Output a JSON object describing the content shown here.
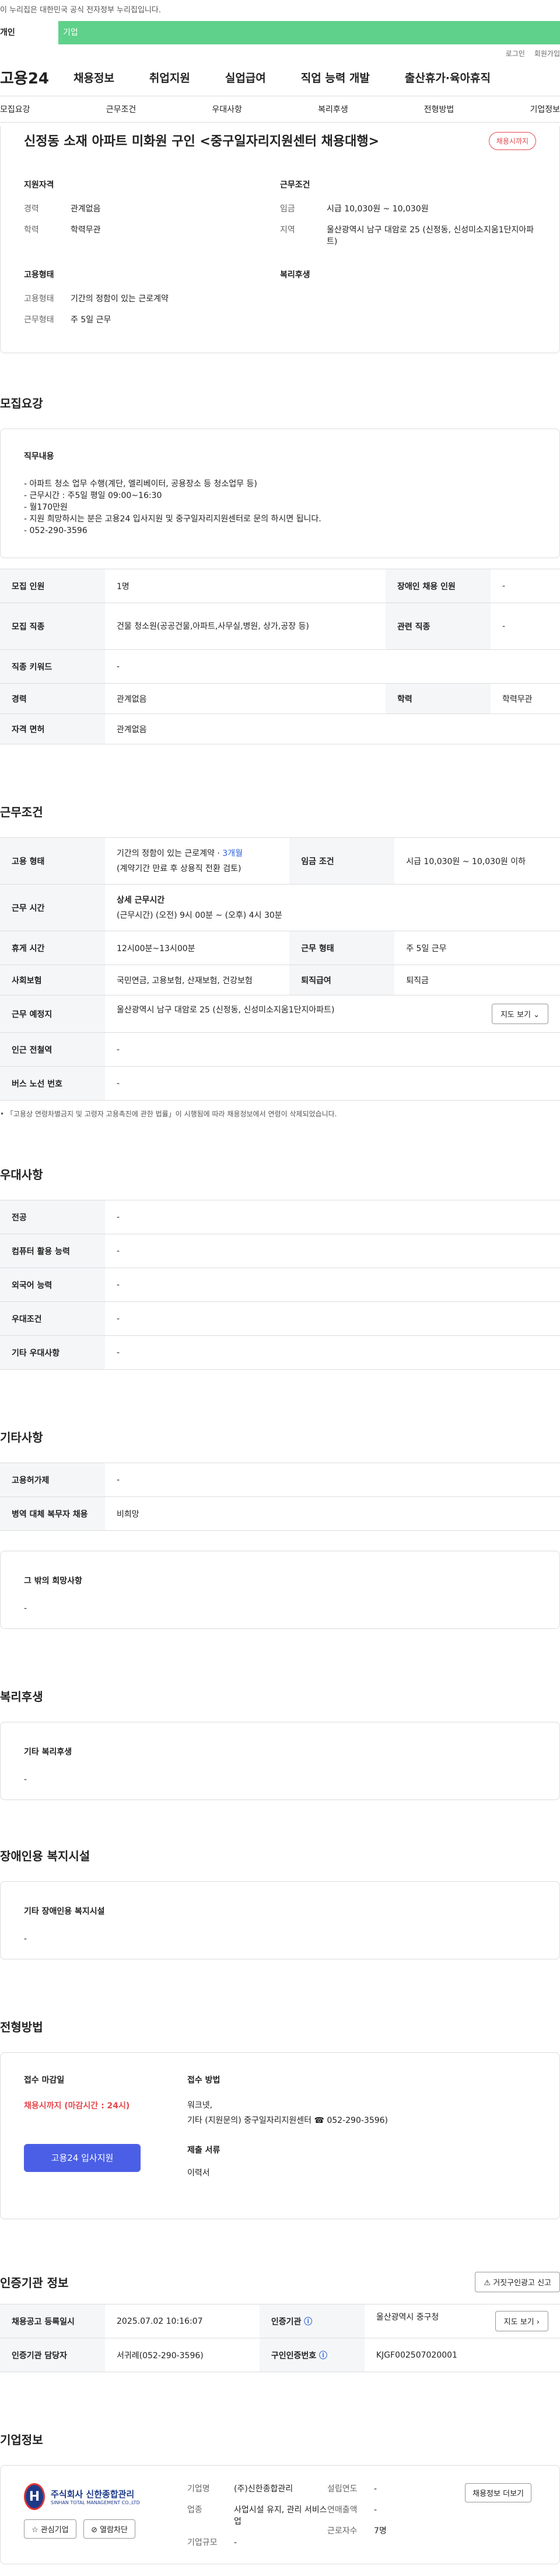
{
  "gov_banner": "이 누리집은 대한민국 공식 전자정부 누리집입니다.",
  "tabs": [
    "개인",
    "기업"
  ],
  "top_links": [
    "로그인",
    "회원가입"
  ],
  "gnb": {
    "logo": "고용24",
    "items": [
      "채용정보",
      "취업지원",
      "실업급여",
      "직업 능력 개발",
      "출산휴가·육아휴직"
    ]
  },
  "subnav": [
    "모집요강",
    "근무조건",
    "우대사항",
    "복리후생",
    "전형방법",
    "기업정보"
  ],
  "job": {
    "title": "신정동 소재 아파트 미화원 구인 <중구일자리지원센터 채용대행>",
    "badge": "채용시까지",
    "qual_title": "지원자격",
    "qual": [
      [
        "경력",
        "관계없음"
      ],
      [
        "학력",
        "학력무관"
      ]
    ],
    "cond_title": "근무조건",
    "cond": [
      [
        "임금",
        "시급 10,030원 ~ 10,030원"
      ],
      [
        "지역",
        "울산광역시 남구 대암로 25 (신정동, 신성미소지움1단지아파트)"
      ]
    ],
    "emp_title": "고용형태",
    "emp": [
      [
        "고용형태",
        "기간의 정함이 있는 근로계약"
      ],
      [
        "근무형태",
        "주 5일 근무"
      ]
    ],
    "benefit_title": "복리후생"
  },
  "recruit": {
    "title": "모집요강",
    "duty_title": "직무내용",
    "duty_lines": [
      "- 아파트 청소 업무 수행(계단, 엘리베이터, 공용장소 등 청소업무 등)",
      "- 근무시간 : 주5일 평일 09:00~16:30",
      "- 월170만원",
      "- 지원 희망하시는 분은 고용24 입사지원 및 중구일자리지원센터로 문의 하시면 됩니다.",
      "- 052-290-3596"
    ],
    "rows": [
      [
        "모집 인원",
        "1명",
        "장애인 채용 인원",
        "-"
      ],
      [
        "모집 직종",
        "건물 청소원(공공건물,아파트,사무실,병원, 상가,공장 등)",
        "관련 직종",
        "-"
      ]
    ],
    "rows2": [
      [
        "직종 키워드",
        "-"
      ]
    ],
    "rows3": [
      [
        "경력",
        "관계없음",
        "학력",
        "학력무관"
      ]
    ],
    "rows4": [
      [
        "자격 면허",
        "관계없음"
      ]
    ]
  },
  "work": {
    "title": "근무조건",
    "emp_type_label": "고용 형태",
    "emp_type": "기간의 정함이 있는 근로계약",
    "emp_months": "3개월",
    "emp_note": "(계약기간 만료 후 상용직 전환 검토)",
    "wage_label": "임금 조건",
    "wage": "시급 10,030원 ~ 10,030원 이하",
    "time_label": "근무 시간",
    "time_head": "상세 근무시간",
    "time_detail": "(근무시간) (오전) 9시 00분 ~ (오후) 4시 30분",
    "rest_label": "휴게 시간",
    "rest": "12시00분~13시00분",
    "form_label": "근무 형태",
    "form": "주 5일 근무",
    "ins_label": "사회보험",
    "ins": "국민연금, 고용보험, 산재보험, 건강보험",
    "ret_label": "퇴직급여",
    "ret": "퇴직금",
    "place_label": "근무 예정지",
    "place": "울산광역시 남구 대암로 25 (신정동, 신성미소지움1단지아파트)",
    "map_btn": "지도 보기",
    "subway_label": "인근 전철역",
    "subway": "-",
    "bus_label": "버스 노선 번호",
    "bus": "-",
    "note": "「고용상 연령차별금지 및 고령자 고용촉진에 관한 법률」이 시행됨에 따라 채용정보에서 연령이 삭제되었습니다."
  },
  "pref": {
    "title": "우대사항",
    "rows": [
      [
        "전공",
        "-"
      ],
      [
        "컴퓨터 활용 능력",
        "-"
      ],
      [
        "외국어 능력",
        "-"
      ],
      [
        "우대조건",
        "-"
      ],
      [
        "기타 우대사항",
        "-"
      ]
    ]
  },
  "etc": {
    "title": "기타사항",
    "rows": [
      [
        "고용허가제",
        "-"
      ],
      [
        "병역 대체 복무자 채용",
        "비희망"
      ]
    ],
    "other_title": "그 밖의 희망사항",
    "other": "-"
  },
  "welfare": {
    "title": "복리후생",
    "box_title": "기타 복리후생",
    "box_val": "-"
  },
  "disab": {
    "title": "장애인용 복지시설",
    "box_title": "기타 장애인용 복지시설",
    "box_val": "-"
  },
  "screen": {
    "title": "전형방법",
    "deadline_title": "접수 마감일",
    "deadline": "채용시까지 (마감시간 : 24시)",
    "method_title": "접수 방법",
    "method1": "워크넷,",
    "method2": "기타 (지원문의) 중구일자리지원센터 ☎ 052-290-3596)",
    "docs_title": "제출 서류",
    "docs": "이력서",
    "apply": "고용24 입사지원"
  },
  "cert": {
    "title": "인증기관 정보",
    "report_btn": "거짓구인광고 신고",
    "rows": [
      [
        "채용공고 등록일시",
        "2025.07.02 10:16:07",
        "인증기관",
        "울산광역시 중구청"
      ],
      [
        "인증기관 담당자",
        "서귀례(052-290-3596)",
        "구인인증번호",
        "KJGF002507020001"
      ]
    ],
    "map_btn": "지도 보기"
  },
  "company": {
    "title": "기업정보",
    "logo_text": "주식회사 신한종합관리",
    "logo_sub": "SINHAN TOTAL MANAGEMENT CO.,LTD",
    "interest": "관심기업",
    "block": "열람차단",
    "rows": [
      [
        "기업명",
        "(주)신한종합관리"
      ],
      [
        "업종",
        "사업시설 유지, 관리 서비스업"
      ],
      [
        "기업규모",
        "-"
      ]
    ],
    "rows2": [
      [
        "설립연도",
        "-"
      ],
      [
        "연매출액",
        "-"
      ],
      [
        "근로자수",
        "7명"
      ]
    ],
    "view_btn": "채용정보 더보기"
  }
}
